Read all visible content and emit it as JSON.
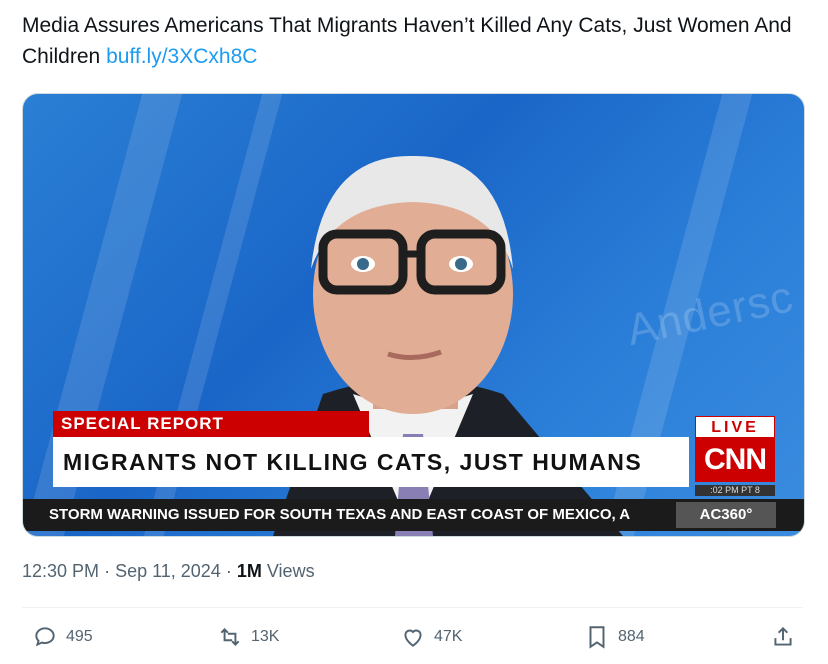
{
  "tweet": {
    "text": "Media Assures Americans That Migrants Haven’t Killed Any Cats, Just Women And Children",
    "link": "buff.ly/3XCxh8C"
  },
  "broadcast": {
    "special_report": "SPECIAL REPORT",
    "headline": "MIGRANTS NOT KILLING CATS, JUST HUMANS",
    "live": "LIVE",
    "network": "CNN",
    "time": ":02 PM PT  8",
    "ticker": "STORM WARNING ISSUED FOR SOUTH TEXAS AND EAST COAST OF MEXICO, A",
    "show": "AC360°",
    "watermark": "Andersc"
  },
  "meta": {
    "time": "12:30 PM",
    "date": "Sep 11, 2024",
    "views_count": "1M",
    "views_label": "Views"
  },
  "actions": {
    "replies": "495",
    "reposts": "13K",
    "likes": "47K",
    "bookmarks": "884"
  },
  "colors": {
    "link": "#1d9bf0",
    "cnn_red": "#cc0000",
    "muted": "#536471"
  }
}
